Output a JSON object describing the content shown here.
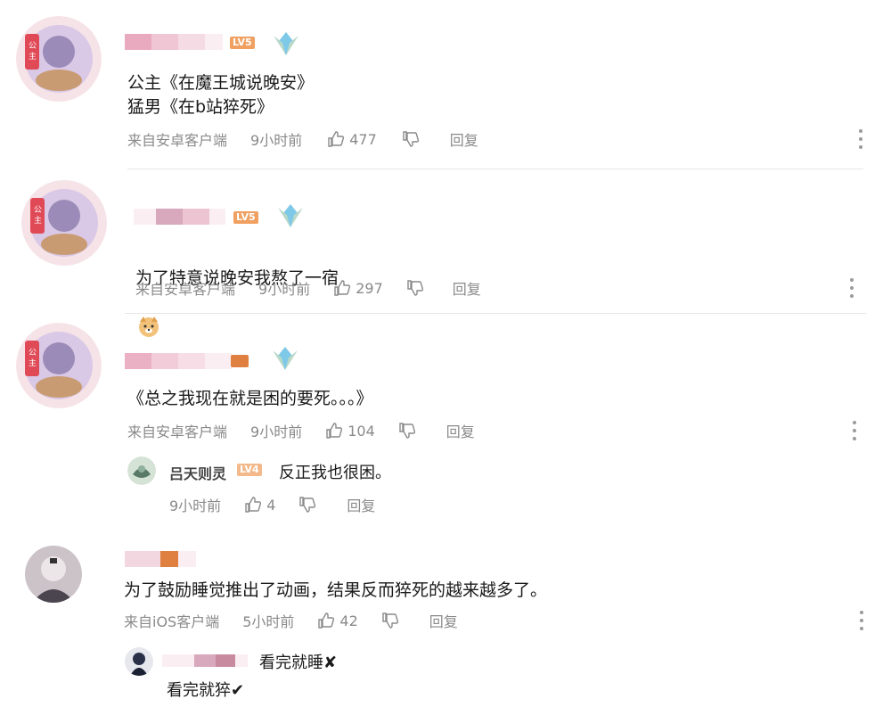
{
  "comments": [
    {
      "level_badge": "LV5",
      "content": "公主《在魔王城说晚安》\n猛男《在b站猝死》",
      "source": "来自安卓客户端",
      "time": "9小时前",
      "likes": "477",
      "reply_label": "回复"
    },
    {
      "level_badge": "LV5",
      "content": "为了特意说晚安我熬了一宿",
      "emoji": "doge-emoji",
      "source": "来自安卓客户端",
      "time": "9小时前",
      "likes": "297",
      "reply_label": "回复"
    },
    {
      "content": "《总之我现在就是困的要死。。。》",
      "source": "来自安卓客户端",
      "time": "9小时前",
      "likes": "104",
      "reply_label": "回复",
      "reply": {
        "name": "吕天则灵",
        "level_badge": "LV4",
        "text": "反正我也很困。",
        "time": "9小时前",
        "likes": "4",
        "reply_label": "回复"
      }
    },
    {
      "content": "为了鼓励睡觉推出了动画，结果反而猝死的越来越多了。",
      "source": "来自iOS客户端",
      "time": "5小时前",
      "likes": "42",
      "reply_label": "回复",
      "reply": {
        "text_line1": "看完就睡✘",
        "text_line2": "看完就猝✔"
      }
    }
  ],
  "colors": {
    "meta_gray": "#8a8a8a",
    "level_orange": "#f0a060",
    "blur_pink": "#e8b6c8"
  }
}
